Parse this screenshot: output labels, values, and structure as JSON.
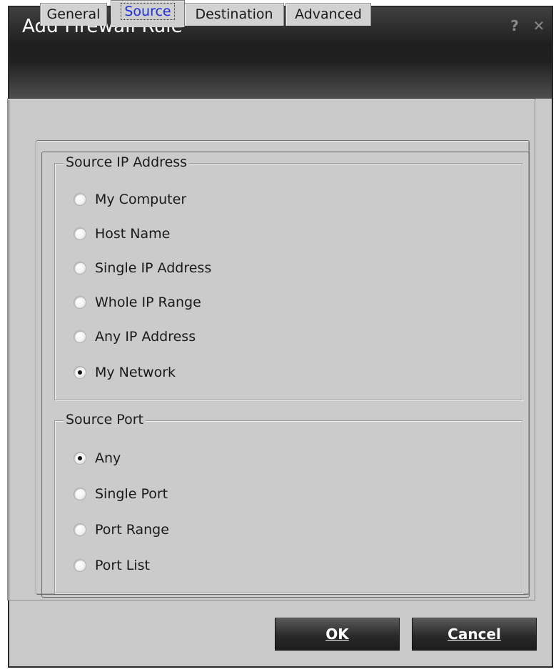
{
  "window": {
    "title": "Add Firewall Rule",
    "help_glyph": "?",
    "close_glyph": "✕"
  },
  "tabs": [
    {
      "label": "General",
      "active": false
    },
    {
      "label": "Source",
      "active": true
    },
    {
      "label": "Destination",
      "active": false
    },
    {
      "label": "Advanced",
      "active": false
    }
  ],
  "source_ip": {
    "legend": "Source IP Address",
    "options": [
      {
        "label": "My Computer",
        "checked": false
      },
      {
        "label": "Host Name",
        "checked": false
      },
      {
        "label": "Single IP Address",
        "checked": false
      },
      {
        "label": "Whole IP Range",
        "checked": false
      },
      {
        "label": "Any IP Address",
        "checked": false
      },
      {
        "label": "My Network",
        "checked": true
      }
    ]
  },
  "source_port": {
    "legend": "Source Port",
    "options": [
      {
        "label": "Any",
        "checked": true
      },
      {
        "label": "Single Port",
        "checked": false
      },
      {
        "label": "Port Range",
        "checked": false
      },
      {
        "label": "Port List",
        "checked": false
      }
    ]
  },
  "buttons": {
    "ok": "OK",
    "cancel": "Cancel"
  },
  "colors": {
    "active_tab_text": "#1f2fd6",
    "titlebar": "#202020",
    "dialog_bg": "#c9c9c9"
  }
}
